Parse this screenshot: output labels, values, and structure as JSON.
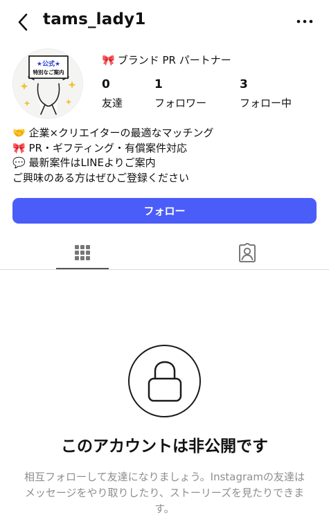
{
  "header": {
    "username": "tams_lady1"
  },
  "avatar": {
    "line1": "★公式★",
    "line2": "特別なご案内"
  },
  "profile": {
    "category_icon": "ribbon-emoji",
    "category": "ブランド PR パートナー",
    "stats": [
      {
        "value": "0",
        "label": "友達"
      },
      {
        "value": "1",
        "label": "フォロワー"
      },
      {
        "value": "3",
        "label": "フォロー中"
      }
    ]
  },
  "bio": {
    "lines": [
      {
        "emoji": "🤝",
        "text": "企業×クリエイターの最適なマッチング"
      },
      {
        "emoji": "🎀",
        "text": "PR・ギフティング・有償案件対応"
      },
      {
        "emoji": "💬",
        "text": "最新案件はLINEよりご案内"
      },
      {
        "emoji": "",
        "text": "ご興味のある方はぜひご登録ください"
      }
    ]
  },
  "follow_button": {
    "label": "フォロー",
    "color": "#4a5df9"
  },
  "tabs": [
    {
      "icon": "grid-icon",
      "active": true
    },
    {
      "icon": "tagged-person-icon",
      "active": false
    }
  ],
  "private": {
    "title": "このアカウントは非公開です",
    "description": "相互フォローして友達になりましょう。Instagramの友達はメッセージをやり取りしたり、ストーリーズを見たりできます。"
  }
}
